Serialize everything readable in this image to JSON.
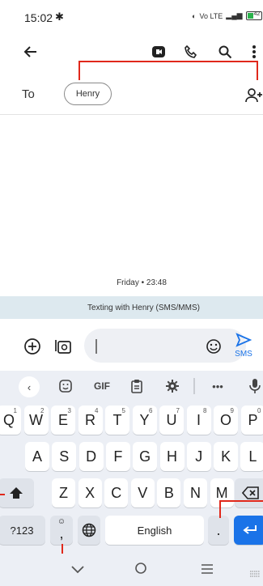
{
  "status_bar": {
    "time": "15:02",
    "right_text": "Vo LTE",
    "battery": "42"
  },
  "header": {
    "back_label": "←"
  },
  "recipient": {
    "to_label": "To",
    "chip_name": "Henry"
  },
  "conversation": {
    "date": "Friday • 23:48",
    "banner": "Texting with Henry (SMS/MMS)"
  },
  "compose": {
    "send_label": "SMS"
  },
  "keyboard": {
    "toolbar": {
      "gif": "GIF"
    },
    "row1": [
      {
        "k": "Q",
        "n": "1"
      },
      {
        "k": "W",
        "n": "2"
      },
      {
        "k": "E",
        "n": "3"
      },
      {
        "k": "R",
        "n": "4"
      },
      {
        "k": "T",
        "n": "5"
      },
      {
        "k": "Y",
        "n": "6"
      },
      {
        "k": "U",
        "n": "7"
      },
      {
        "k": "I",
        "n": "8"
      },
      {
        "k": "O",
        "n": "9"
      },
      {
        "k": "P",
        "n": "0"
      }
    ],
    "row2": [
      "A",
      "S",
      "D",
      "F",
      "G",
      "H",
      "J",
      "K",
      "L"
    ],
    "row3": [
      "Z",
      "X",
      "C",
      "V",
      "B",
      "N",
      "M"
    ],
    "symbols_label": "?123",
    "comma": ",",
    "space_label": "English",
    "period": "."
  },
  "colors": {
    "accent": "#1a73e8",
    "callout": "#e0281b",
    "banner": "#dde9ef",
    "keyboard_bg": "#eceff5"
  }
}
